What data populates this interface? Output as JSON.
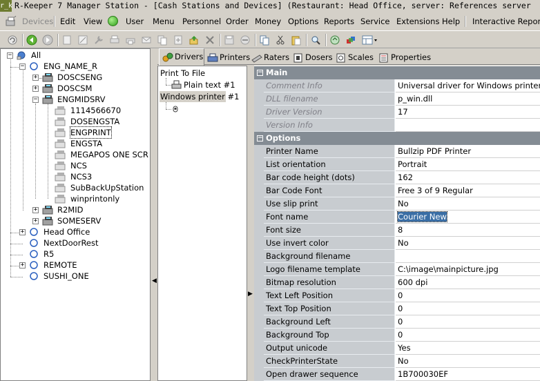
{
  "window": {
    "logo_text": "r_k",
    "title": "R-Keeper 7 Manager Station - [Cash Stations and Devices] (Restaurant: Head Office, server: References server"
  },
  "menu": {
    "devices": "Devices",
    "edit": "Edit",
    "view": "View",
    "user": "User",
    "menu": "Menu",
    "personnel": "Personnel",
    "order": "Order",
    "money": "Money",
    "options": "Options",
    "reports": "Reports",
    "service": "Service",
    "extensions": "Extensions",
    "help": "Help",
    "interactive_reports": "Interactive Reports (I"
  },
  "left_tree": {
    "all": "All",
    "eng_name_r": "ENG_NAME_R",
    "doscseng": "DOSCSENG",
    "doscsm": "DOSCSM",
    "engmidsrv": "ENGMIDSRV",
    "n1114566670": "1114566670",
    "dosengsta": "DOSENGSTA",
    "engprint": "ENGPRINT",
    "engsta": "ENGSTA",
    "megapos": "MEGAPOS ONE SCR",
    "ncs": "NCS",
    "ncs3": "NCS3",
    "subbackup": "SubBackUpStation",
    "winprintonly": "winprintonly",
    "r2mid": "R2MID",
    "someserv": "SOMESERV",
    "head_office": "Head Office",
    "nextdoor": "NextDoorRest",
    "r5": "R5",
    "remote": "REMOTE",
    "sushi_one": "SUSHI_ONE"
  },
  "tabs": {
    "drivers": "Drivers",
    "printers": "Printers",
    "raters": "Raters",
    "dosers": "Dosers",
    "scales": "Scales",
    "properties": "Properties"
  },
  "driver_tree": {
    "print_to_file": "Print To File",
    "plain_text": "Plain text #1",
    "windows_printer": "Windows printer #1"
  },
  "props": {
    "main_title": "Main",
    "options_title": "Options",
    "main": [
      {
        "name": "Comment Info",
        "value": "Universal driver for Windows printers"
      },
      {
        "name": "DLL filename",
        "value": "p_win.dll"
      },
      {
        "name": "Driver Version",
        "value": "17"
      },
      {
        "name": "Version Info",
        "value": ""
      }
    ],
    "options": [
      {
        "name": "Printer Name",
        "value": "Bullzip PDF Printer"
      },
      {
        "name": "List orientation",
        "value": "Portrait"
      },
      {
        "name": "Bar code height (dots)",
        "value": "162"
      },
      {
        "name": "Bar Code Font",
        "value": "Free 3 of 9 Regular"
      },
      {
        "name": "Use slip print",
        "value": "No"
      },
      {
        "name": "Font name",
        "value": "Courier New"
      },
      {
        "name": "Font size",
        "value": "8"
      },
      {
        "name": "Use invert color",
        "value": "No"
      },
      {
        "name": "Background filename",
        "value": ""
      },
      {
        "name": "Logo filename template",
        "value": "C:\\image\\mainpicture.jpg"
      },
      {
        "name": "Bitmap resolution",
        "value": "600 dpi"
      },
      {
        "name": "Text Left Position",
        "value": "0"
      },
      {
        "name": "Text Top Position",
        "value": "0"
      },
      {
        "name": "Background Left",
        "value": "0"
      },
      {
        "name": "Background Top",
        "value": "0"
      },
      {
        "name": "Output unicode",
        "value": "Yes"
      },
      {
        "name": "CheckPrinterState",
        "value": "No"
      },
      {
        "name": "Open drawer sequence",
        "value": "1B700030EF"
      }
    ]
  },
  "colors": {
    "section_header": "#848c94",
    "name_column": "#c8ccd0",
    "selection": "#3a6ea5"
  }
}
